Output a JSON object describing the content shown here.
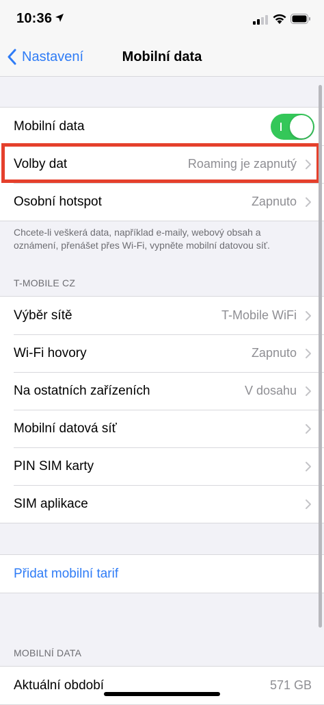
{
  "status_bar": {
    "time": "10:36"
  },
  "nav": {
    "back_label": "Nastavení",
    "title": "Mobilní data"
  },
  "group1": [
    {
      "label": "Mobilní data",
      "toggle_on": true
    },
    {
      "label": "Volby dat",
      "value": "Roaming je zapnutý"
    },
    {
      "label": "Osobní hotspot",
      "value": "Zapnuto"
    }
  ],
  "footnote": "Chcete-li veškerá data, například e-maily, webový obsah a oznámení, přenášet přes Wi-Fi, vypněte mobilní datovou síť.",
  "carrier_header": "T-MOBILE CZ",
  "group2": [
    {
      "label": "Výběr sítě",
      "value": "T-Mobile WiFi"
    },
    {
      "label": "Wi-Fi hovory",
      "value": "Zapnuto"
    },
    {
      "label": "Na ostatních zařízeních",
      "value": "V dosahu"
    },
    {
      "label": "Mobilní datová síť",
      "value": ""
    },
    {
      "label": "PIN SIM karty",
      "value": ""
    },
    {
      "label": "SIM aplikace",
      "value": ""
    }
  ],
  "add_plan": {
    "label": "Přidat mobilní tarif"
  },
  "usage_header": "MOBILNÍ DATA",
  "usage": {
    "label": "Aktuální období",
    "value": "571 GB"
  },
  "colors": {
    "accent": "#2f7cf6",
    "toggle_on": "#34c759",
    "highlight": "#e5402c"
  }
}
